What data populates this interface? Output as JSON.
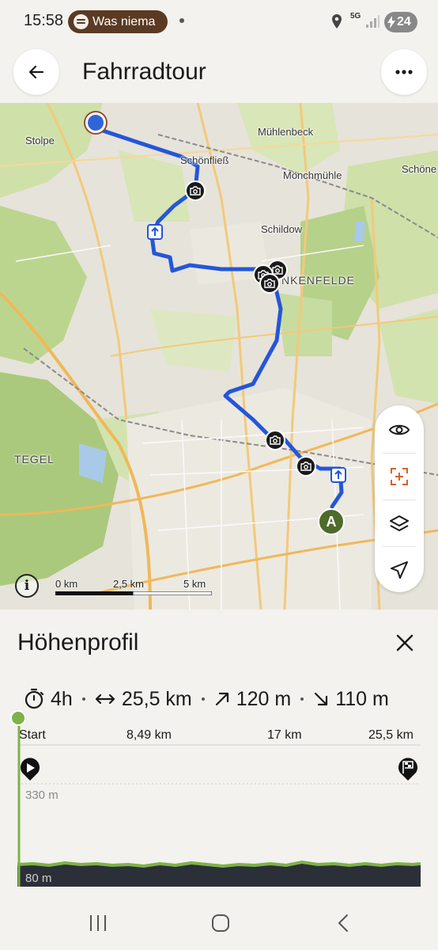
{
  "status_bar": {
    "time": "15:58",
    "media_pill": "Was niema",
    "network": "5G",
    "battery": "24"
  },
  "header": {
    "title": "Fahrradtour",
    "back_icon": "arrow-left-icon",
    "more_icon": "more-horizontal-icon"
  },
  "map": {
    "place_labels": {
      "stolpe": "Stolpe",
      "schoenfliess": "Schönfließ",
      "muehlenbeck": "Mühlenbeck",
      "moenchmuehle": "Mönchmühle",
      "schoene": "Schöne",
      "schildow": "Schildow",
      "blankenfelde": "NKENFELDE",
      "tegel": "TEGEL"
    },
    "start_marker": "A",
    "route_color": "#2456d9",
    "scale": {
      "label_0": "0 km",
      "label_1": "2,5 km",
      "label_2": "5 km"
    },
    "controls": [
      "eye-icon",
      "recenter-icon",
      "layers-icon",
      "navigation-icon"
    ],
    "info_label": "i"
  },
  "elevation": {
    "title": "Höhenprofil",
    "stats": {
      "duration": "4h",
      "distance": "25,5 km",
      "ascent": "120 m",
      "descent": "110 m"
    },
    "axis": {
      "start": "Start",
      "km_1": "8,49 km",
      "km_2": "17 km",
      "km_3": "25,5 km"
    },
    "y_max_label": "330 m",
    "y_min_label": "80 m",
    "accent_color": "#7fb24a"
  },
  "navbar": [
    "recents-icon",
    "home-icon",
    "back-icon"
  ]
}
